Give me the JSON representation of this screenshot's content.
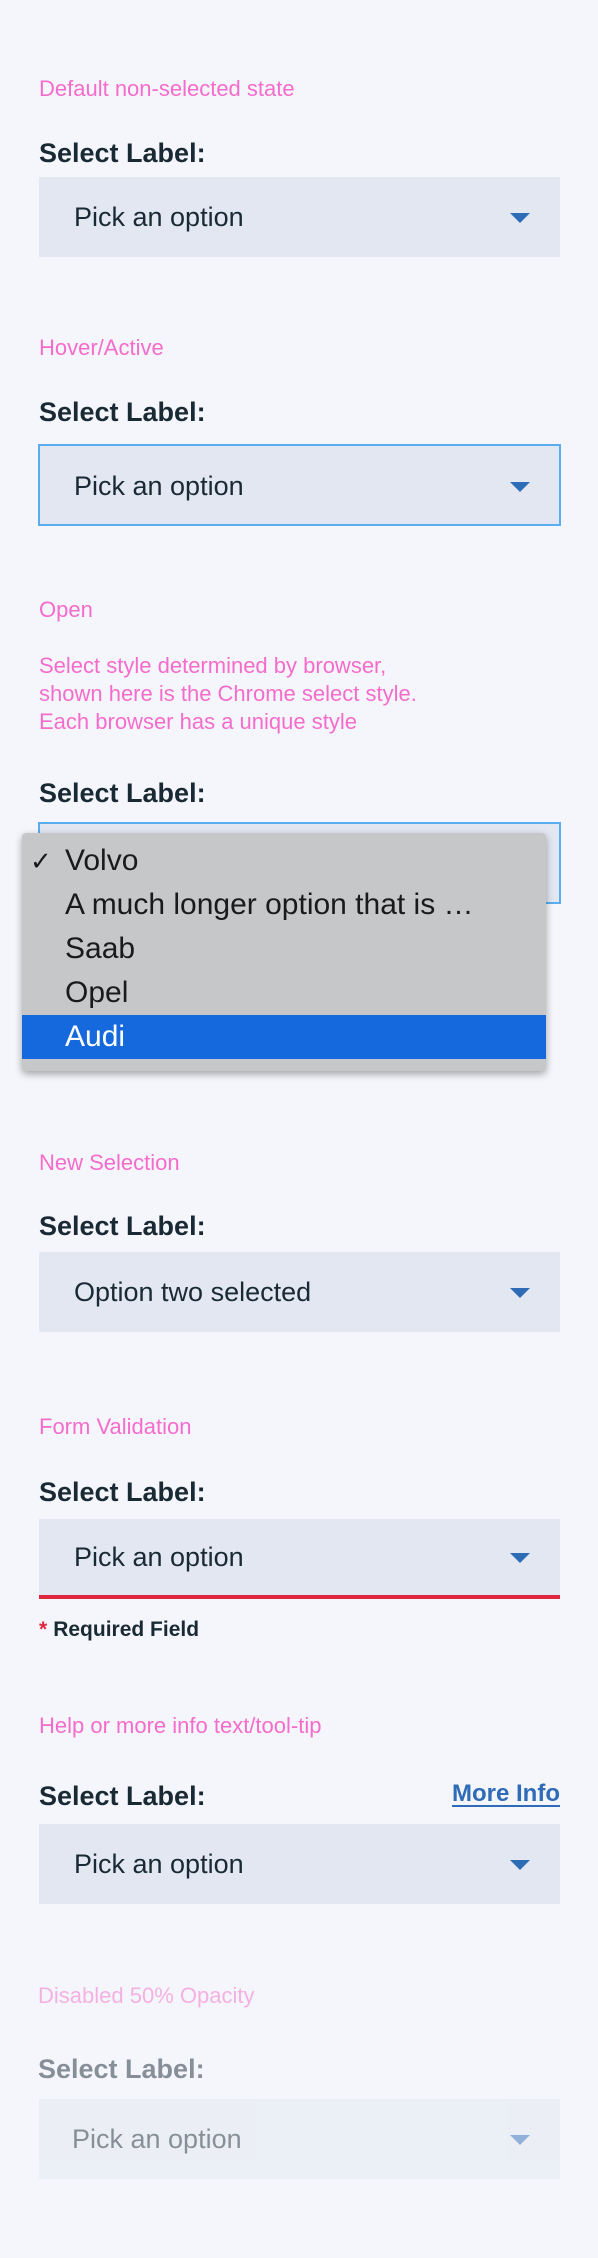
{
  "colors": {
    "note": "#f56ccc",
    "field_bg": "#e2e7f1",
    "caret": "#2f6cb8",
    "hover_border": "#5aaef0",
    "error": "#e0263d",
    "link": "#2f6cb8",
    "native_highlight": "#1669dc"
  },
  "states": {
    "default": {
      "note": "Default non-selected state",
      "label": "Select Label:",
      "value": "Pick an option",
      "icon": "chevron-down-icon"
    },
    "hover": {
      "note": "Hover/Active",
      "label": "Select Label:",
      "value": "Pick an option",
      "icon": "chevron-down-icon"
    },
    "open": {
      "note": "Open",
      "note_line1": "Select style determined by browser,",
      "note_line2": "shown here is the Chrome select style.",
      "note_line3": "Each browser has a unique style",
      "label": "Select Label:",
      "options": [
        {
          "label": "Volvo",
          "checked": "✓"
        },
        {
          "label": "A much longer option that is …",
          "checked": ""
        },
        {
          "label": "Saab",
          "checked": ""
        },
        {
          "label": "Opel",
          "checked": ""
        },
        {
          "label": "Audi",
          "checked": ""
        }
      ],
      "highlighted_option": "Audi"
    },
    "new_selection": {
      "note": "New Selection",
      "label": "Select Label:",
      "value": "Option two selected",
      "icon": "chevron-down-icon"
    },
    "validation": {
      "note": "Form Validation",
      "label": "Select Label:",
      "value": "Pick an option",
      "required_star": "*",
      "required_text": "Required Field",
      "icon": "chevron-down-icon"
    },
    "help": {
      "note": "Help or more info text/tool-tip",
      "label": "Select Label:",
      "link": "More Info",
      "value": "Pick an option",
      "icon": "chevron-down-icon"
    },
    "disabled": {
      "note": "Disabled 50% Opacity",
      "label": "Select Label:",
      "value": "Pick an option",
      "icon": "chevron-down-icon"
    }
  }
}
